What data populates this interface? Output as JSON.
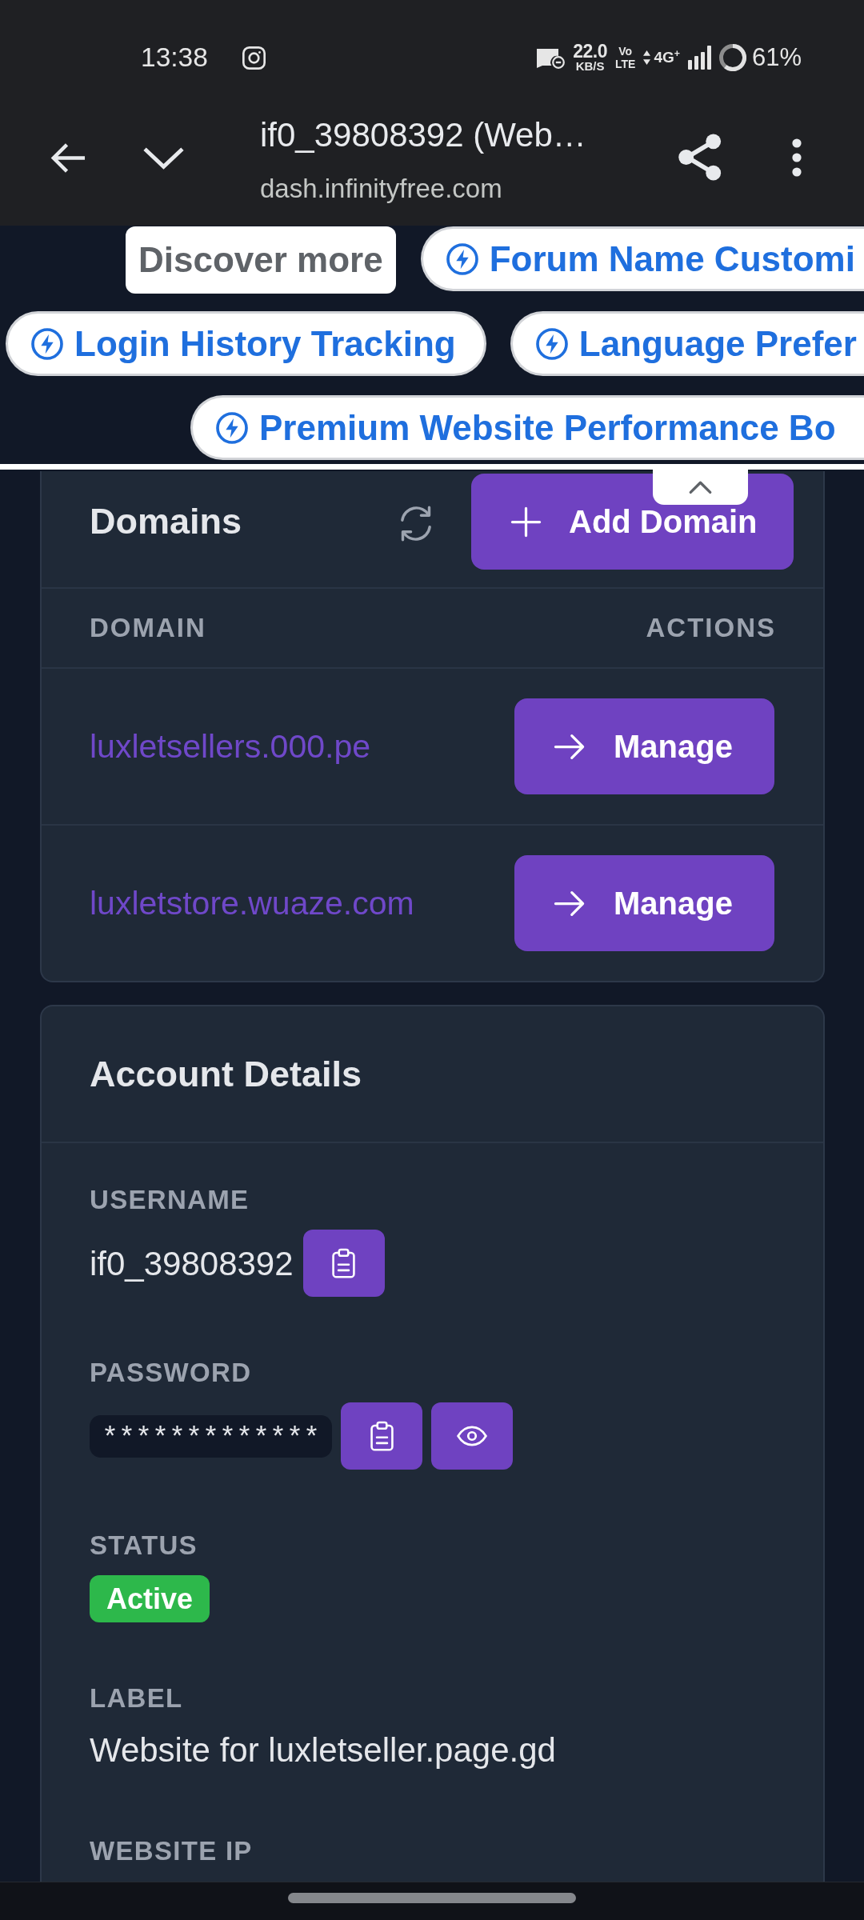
{
  "status_bar": {
    "time": "13:38",
    "speed": "22.0",
    "speed_unit": "KB/S",
    "volte": [
      "Vo",
      "LTE"
    ],
    "network": "4G$^{+}$",
    "battery": "61%"
  },
  "browser_bar": {
    "title": "if0_39808392 (Web…",
    "url": "dash.infinityfree.com"
  },
  "ad_overlay": {
    "rows": [
      [
        {
          "kind": "label",
          "text": "Discover more"
        },
        {
          "kind": "chip",
          "text": "Forum Name Customi"
        }
      ],
      [
        {
          "kind": "chip",
          "text": "Login History Tracking"
        },
        {
          "kind": "chip",
          "text": "Language Prefer"
        }
      ],
      [
        {
          "kind": "chip",
          "text": "Premium Website Performance Bo"
        }
      ]
    ]
  },
  "domains_card": {
    "title": "Domains",
    "add_button": "Add Domain",
    "columns": [
      "DOMAIN",
      "ACTIONS"
    ],
    "rows": [
      {
        "domain": "luxletsellers.000.pe",
        "action": "Manage"
      },
      {
        "domain": "luxletstore.wuaze.com",
        "action": "Manage"
      }
    ]
  },
  "account_card": {
    "title": "Account Details",
    "fields": [
      {
        "kind": "copy",
        "label": "USERNAME",
        "value": "if0_39808392"
      },
      {
        "kind": "secret",
        "label": "PASSWORD",
        "value": "*************"
      },
      {
        "kind": "badge",
        "label": "STATUS",
        "value": "Active"
      },
      {
        "kind": "text",
        "label": "LABEL",
        "value": "Website for luxletseller.page.gd"
      },
      {
        "kind": "text",
        "label": "WEBSITE IP"
      }
    ]
  }
}
